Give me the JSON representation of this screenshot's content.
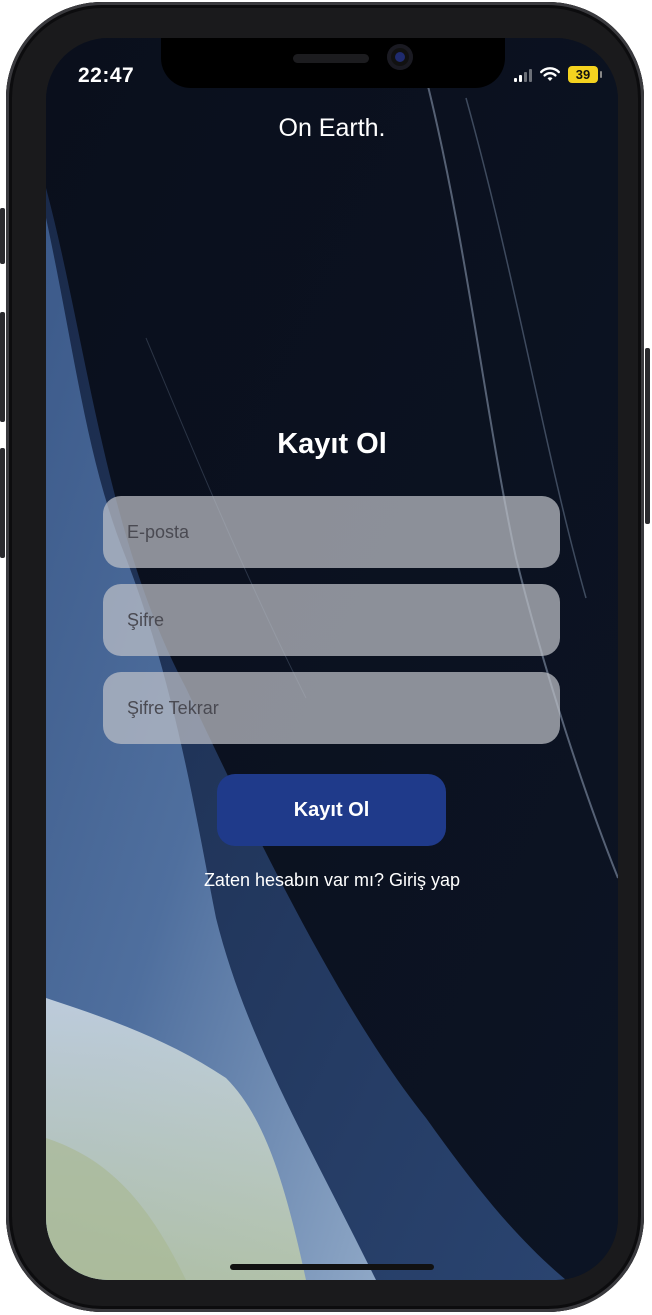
{
  "status_bar": {
    "time": "22:47",
    "battery": "39"
  },
  "app": {
    "title": "On Earth."
  },
  "register_form": {
    "title": "Kayıt Ol",
    "email_placeholder": "E-posta",
    "password_placeholder": "Şifre",
    "password_confirm_placeholder": "Şifre Tekrar",
    "submit_label": "Kayıt Ol",
    "login_prompt": "Zaten hesabın var mı? Giriş yap"
  },
  "colors": {
    "button": "#1f3a8a",
    "field": "#bec0c8",
    "ocean": "#0b1220",
    "battery": "#f4d21f"
  },
  "icons": [
    "signal-icon",
    "wifi-icon",
    "battery-icon"
  ]
}
